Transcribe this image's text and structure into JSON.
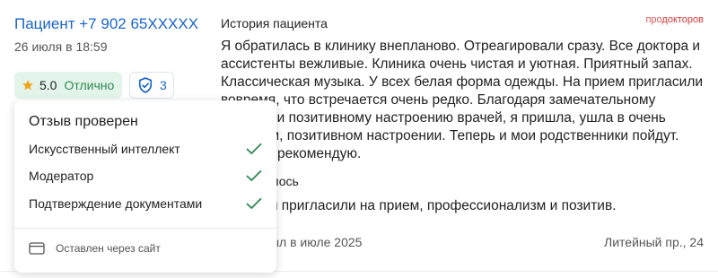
{
  "header": {
    "patient_name": "Пациент +7 902 65XXXXX",
    "date": "26 июля в 18:59"
  },
  "rating": {
    "icon": "star-icon",
    "score": "5.0",
    "label": "Отлично",
    "accent": "#2c8a4f",
    "background": "#e3f4ea"
  },
  "verification": {
    "icon": "shield-check-icon",
    "count": "3"
  },
  "brand": {
    "part1": "про",
    "part2": "докторов"
  },
  "review": {
    "story_title": "История пациента",
    "story_text": "Я обратилась в клинику внепланово. Отреагировали сразу. Все доктора и ассистенты вежливые. Клиника очень чистая и уютная. Приятный запах. Классическая музыка. У всех белая форма одежды. На прием пригласили вовремя, что встречается очень редко. Благодаря замечательному подходу и позитивному настроению врачей, я пришла, ушла в очень хорошем, позитивном настроении. Теперь и мои родственники пойдут. Клинику рекомендую.",
    "liked_title": "Понравилось",
    "liked_text": "Вовремя пригласили на прием, профессионализм и позитив.",
    "visit": "Прием был в июле 2025",
    "address": "Литейный пр., 24"
  },
  "popover": {
    "title": "Отзыв проверен",
    "checks": [
      {
        "label": "Искусственный интеллект",
        "icon": "check-icon"
      },
      {
        "label": "Модератор",
        "icon": "check-icon"
      },
      {
        "label": "Подтверждение документами",
        "icon": "check-icon"
      }
    ],
    "check_color": "#2c8a4f",
    "source_icon": "browser-window-icon",
    "source_text": "Оставлен через сайт"
  },
  "colors": {
    "link": "#1a66c8",
    "brand": "#e05a5a"
  }
}
